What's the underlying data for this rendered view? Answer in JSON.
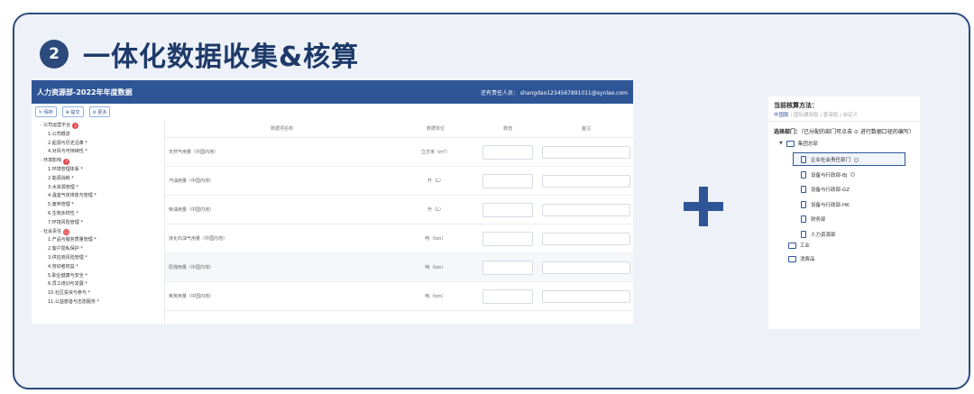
{
  "section": {
    "number": "2",
    "title": "一体化数据收集&核算"
  },
  "app": {
    "title": "人力资源部-2022年年度数据",
    "user_info": "还有责任人员： shangdao1234567891011@synlao.com",
    "toolbar": [
      "↻ 保存",
      "⊕ 提交",
      "⊘ 更多"
    ],
    "tree": [
      {
        "label": "· 公司运营平台",
        "badge": "3",
        "indent": 0
      },
      {
        "label": "1.公司概述",
        "indent": 1
      },
      {
        "label": "2.起源与历史沿革 *",
        "indent": 1
      },
      {
        "label": "4.对风与可持续性 *",
        "indent": 1
      },
      {
        "label": "· 环境影响",
        "badge": "7",
        "indent": 0
      },
      {
        "label": "1.环境管理体系 *",
        "indent": 1
      },
      {
        "label": "2.能源消耗 *",
        "indent": 1
      },
      {
        "label": "3.水资源管理 *",
        "indent": 1
      },
      {
        "label": "4.温室气体排放与管理 *",
        "indent": 1
      },
      {
        "label": "5.废弃管理 *",
        "indent": 1
      },
      {
        "label": "6.生物多样性 *",
        "indent": 1
      },
      {
        "label": "7.环境风险管理 *",
        "indent": 1
      },
      {
        "label": "· 社会责任",
        "badge": "11",
        "indent": 0
      },
      {
        "label": "1.产品与服务质量管理 *",
        "indent": 1
      },
      {
        "label": "2.客户隐私保护 *",
        "indent": 1
      },
      {
        "label": "3.供应商风险管理 *",
        "indent": 1
      },
      {
        "label": "4.劳动者权益 *",
        "indent": 1
      },
      {
        "label": "5.职业健康与安全 *",
        "indent": 1
      },
      {
        "label": "6.员工培训与发展 *",
        "indent": 1
      },
      {
        "label": "10.社区投资与参与 *",
        "indent": 1
      },
      {
        "label": "11.公益慈善与志愿服务 *",
        "indent": 1
      }
    ],
    "grid_headers": [
      "数据项名称",
      "数据单位",
      "数值",
      "备注"
    ],
    "rows": [
      {
        "name": "天然气用量（中国内地）",
        "unit": "立方米（m³）"
      },
      {
        "name": "汽油用量（中国内地）",
        "unit": "升（L）"
      },
      {
        "name": "柴油用量（中国内地）",
        "unit": "升（L）"
      },
      {
        "name": "液化石油气用量（中国内地）",
        "unit": "吨（ton）"
      },
      {
        "name": "原煤用量（中国内地）",
        "unit": "吨（ton）"
      },
      {
        "name": "焦炭用量（中国内地）",
        "unit": "吨（ton）"
      }
    ]
  },
  "panel": {
    "title": "当前核算方法：",
    "method_active": "中国版",
    "methods_rest": "| 国际通用版 | 香港版 | 自定义",
    "dept_label": "选择部门：",
    "dept_hint": "（已分配的部门可点击 ⊙ 进行数据口径的编写）",
    "group": "集团总部",
    "items": [
      "企业社会责任部门",
      "设备与行政部-BJ",
      "设备与行政部-GZ",
      "设备与行政部-HK",
      "财务部",
      "人力资源部"
    ],
    "others": [
      "工业",
      "消费品"
    ]
  },
  "colors": {
    "brand": "#2f5597",
    "frame": "#2c4a7c"
  }
}
